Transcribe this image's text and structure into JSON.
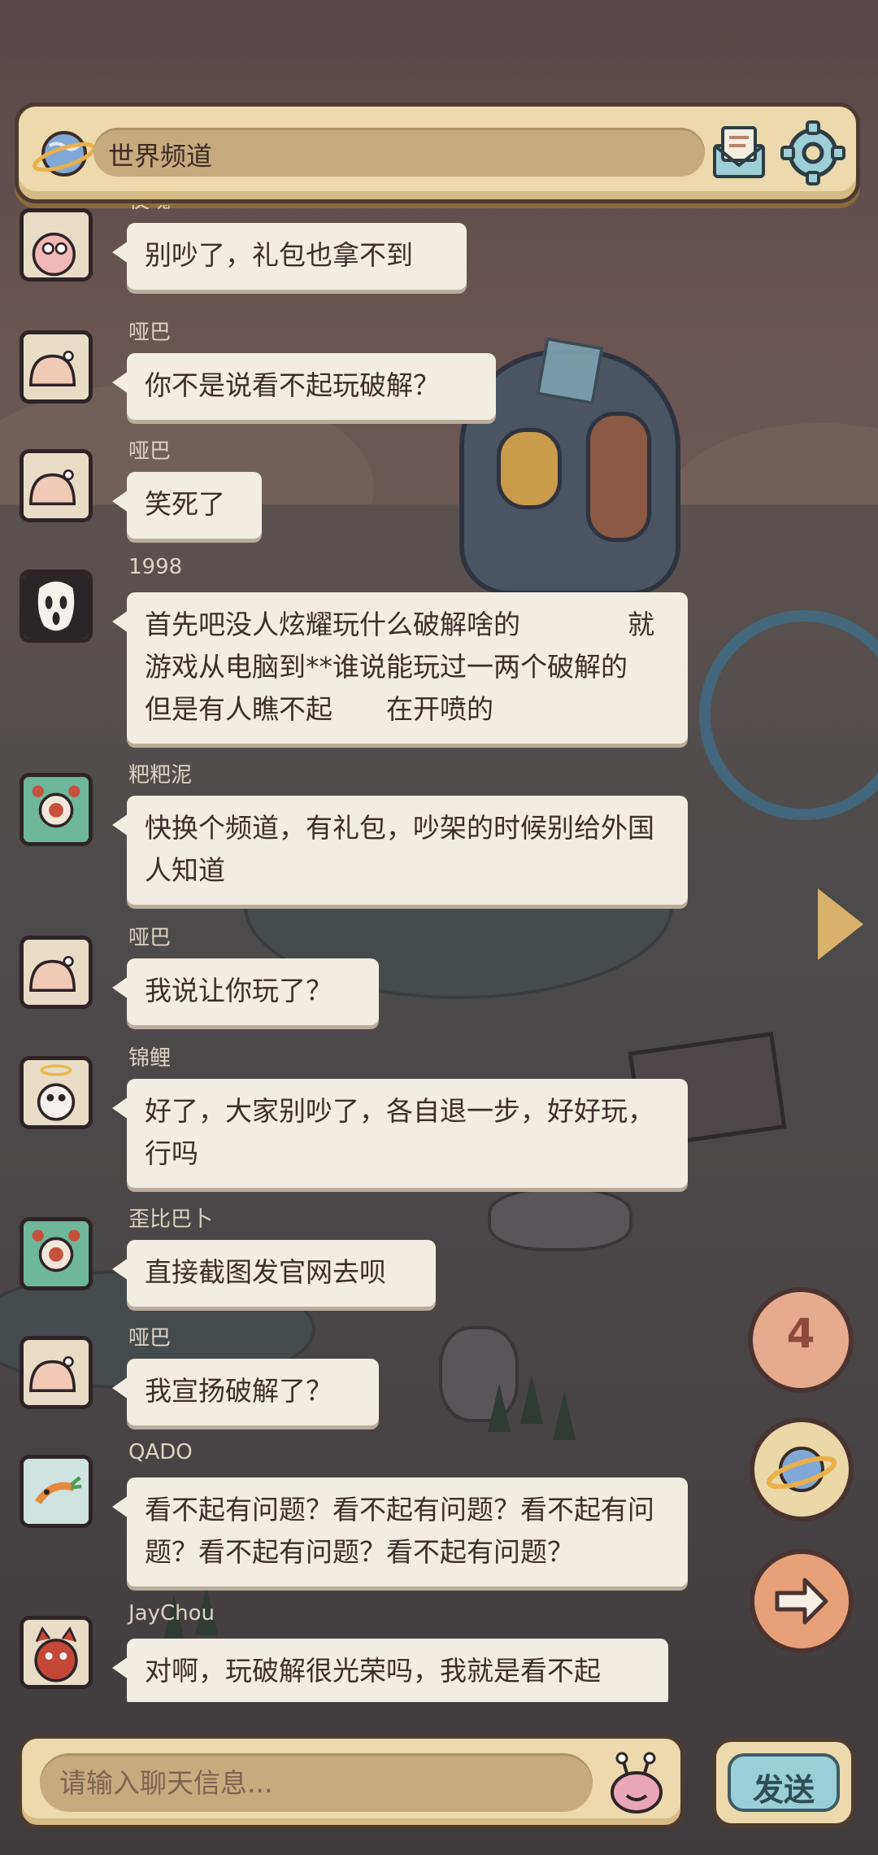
{
  "header": {
    "channel_name": "世界频道"
  },
  "messages": [
    {
      "user": "仗魂",
      "text": "别吵了，礼包也拿不到",
      "avatar": "snail-avatar"
    },
    {
      "user": "哑巴",
      "text": "你不是说看不起玩破解？",
      "avatar": "snail-avatar"
    },
    {
      "user": "哑巴",
      "text": "笑死了",
      "avatar": "snail-avatar"
    },
    {
      "user": "1998",
      "text": "首先吧没人炫耀玩什么破解啥的　　　　就游戏从电脑到**谁说能玩过一两个破解的　　　但是有人瞧不起　　在开喷的",
      "avatar": "ghostface-avatar"
    },
    {
      "user": "粑粑泥",
      "text": "快换个频道，有礼包，吵架的时候别给外国人知道",
      "avatar": "frog-avatar"
    },
    {
      "user": "哑巴",
      "text": "我说让你玩了？",
      "avatar": "snail-avatar"
    },
    {
      "user": "锦鲤",
      "text": "好了，大家别吵了，各自退一步，好好玩，行吗",
      "avatar": "halo-snail-avatar"
    },
    {
      "user": "歪比巴卜",
      "text": "直接截图发官网去呗",
      "avatar": "frog-avatar"
    },
    {
      "user": "哑巴",
      "text": "我宣扬破解了？",
      "avatar": "snail-avatar"
    },
    {
      "user": "QADO",
      "text": "看不起有问题？看不起有问题？看不起有问题？看不起有问题？看不起有问题？",
      "avatar": "carrot-avatar"
    },
    {
      "user": "JayChou",
      "text": "对啊，玩破解很光荣吗，我就是看不起",
      "avatar": "devil-avatar"
    }
  ],
  "unread_count": "4",
  "input": {
    "placeholder": "请输入聊天信息..."
  },
  "send_label": "发送",
  "colors": {
    "panel": "#ecd9ad",
    "panel_border": "#4d3a31",
    "bubble": "#f2ede1",
    "send_button": "#9bcfd8",
    "unread_badge": "#e6aa8e"
  }
}
